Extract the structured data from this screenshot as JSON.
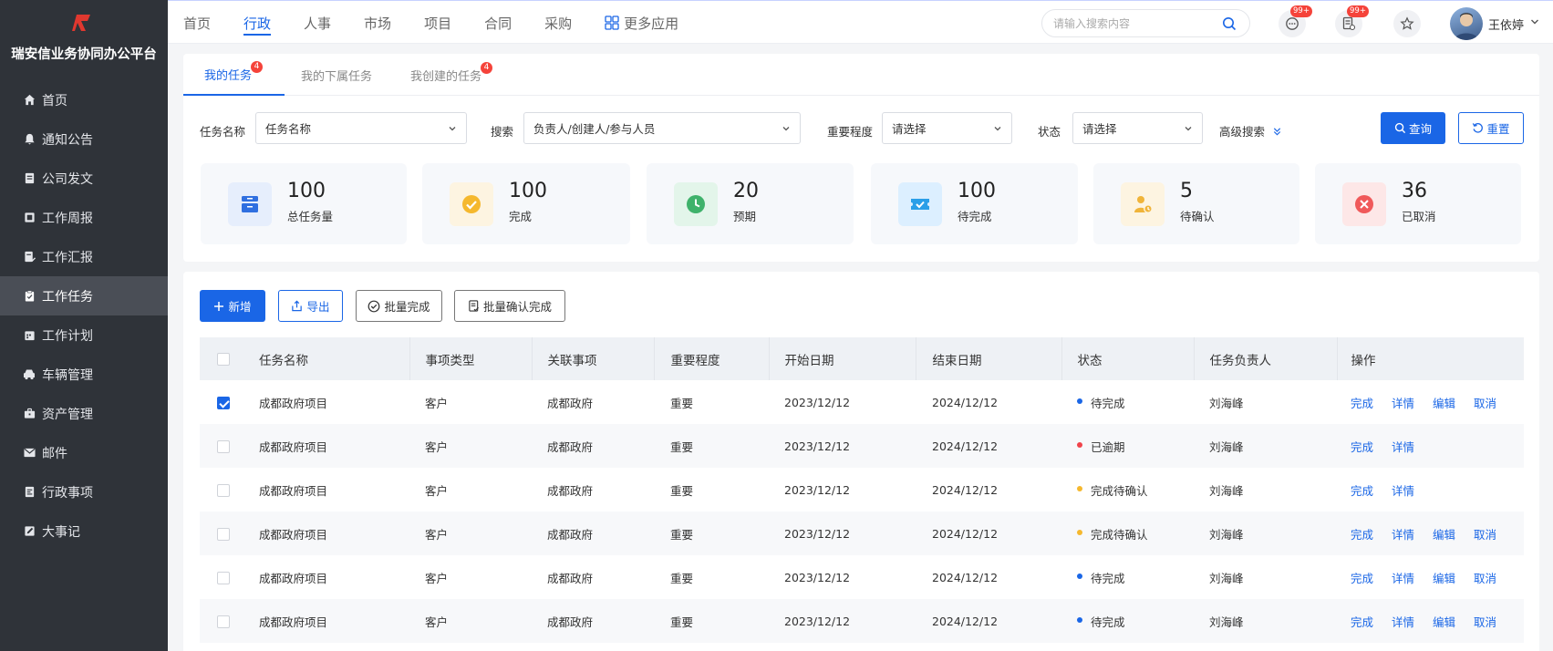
{
  "app": {
    "title": "瑞安信业务协同办公平台"
  },
  "sidebar": {
    "items": [
      {
        "label": "首页",
        "icon": "home-icon"
      },
      {
        "label": "通知公告",
        "icon": "bell-icon"
      },
      {
        "label": "公司发文",
        "icon": "document-icon"
      },
      {
        "label": "工作周报",
        "icon": "report-icon"
      },
      {
        "label": "工作汇报",
        "icon": "edit-document-icon"
      },
      {
        "label": "工作任务",
        "icon": "clipboard-icon",
        "active": true
      },
      {
        "label": "工作计划",
        "icon": "calendar-icon"
      },
      {
        "label": "车辆管理",
        "icon": "car-icon"
      },
      {
        "label": "资产管理",
        "icon": "briefcase-icon"
      },
      {
        "label": "邮件",
        "icon": "mail-icon"
      },
      {
        "label": "行政事项",
        "icon": "file-icon"
      },
      {
        "label": "大事记",
        "icon": "pencil-note-icon"
      }
    ]
  },
  "topnav": {
    "items": [
      "首页",
      "行政",
      "人事",
      "市场",
      "项目",
      "合同",
      "采购",
      "更多应用"
    ],
    "active": "行政"
  },
  "search": {
    "placeholder": "请输入搜索内容"
  },
  "notifications": {
    "messages_badge": "99+",
    "tasks_badge": "99+"
  },
  "user": {
    "name": "王依婷"
  },
  "tabs": [
    {
      "label": "我的任务",
      "badge": "4"
    },
    {
      "label": "我的下属任务"
    },
    {
      "label": "我创建的任务",
      "badge": "4"
    }
  ],
  "filters": {
    "task_name_label": "任务名称",
    "task_name_value": "任务名称",
    "search_label": "搜索",
    "search_value": "负责人/创建人/参与人员",
    "importance_label": "重要程度",
    "importance_value": "请选择",
    "status_label": "状态",
    "status_value": "请选择",
    "advanced": "高级搜索",
    "query_button": "查询",
    "reset_button": "重置"
  },
  "stats": [
    {
      "value": "100",
      "label": "总任务量",
      "color": "#2f6fe0",
      "bg": "#e6eefc"
    },
    {
      "value": "100",
      "label": "完成",
      "color": "#f5b82e",
      "bg": "#fdf4e1"
    },
    {
      "value": "20",
      "label": "预期",
      "color": "#3fb26b",
      "bg": "#e3f5ea"
    },
    {
      "value": "100",
      "label": "待完成",
      "color": "#2a9fe8",
      "bg": "#dcefff"
    },
    {
      "value": "5",
      "label": "待确认",
      "color": "#f0b43a",
      "bg": "#fdf4e1"
    },
    {
      "value": "36",
      "label": "已取消",
      "color": "#f0595a",
      "bg": "#fde7e7"
    }
  ],
  "actions": {
    "add": "新增",
    "export": "导出",
    "batch_complete": "批量完成",
    "batch_confirm": "批量确认完成"
  },
  "table": {
    "columns": [
      "任务名称",
      "事项类型",
      "关联事项",
      "重要程度",
      "开始日期",
      "结束日期",
      "状态",
      "任务负责人",
      "操作"
    ],
    "rows": [
      {
        "checked": true,
        "name": "成都政府项目",
        "type": "客户",
        "related": "成都政府",
        "importance": "重要",
        "start": "2023/12/12",
        "end": "2024/12/12",
        "status": "待完成",
        "status_color": "#1a66e6",
        "owner": "刘海峰",
        "ops": [
          "完成",
          "详情",
          "编辑",
          "取消"
        ]
      },
      {
        "checked": false,
        "name": "成都政府项目",
        "type": "客户",
        "related": "成都政府",
        "importance": "重要",
        "start": "2023/12/12",
        "end": "2024/12/12",
        "status": "已逾期",
        "status_color": "#f0434a",
        "owner": "刘海峰",
        "ops": [
          "完成",
          "详情"
        ]
      },
      {
        "checked": false,
        "name": "成都政府项目",
        "type": "客户",
        "related": "成都政府",
        "importance": "重要",
        "start": "2023/12/12",
        "end": "2024/12/12",
        "status": "完成待确认",
        "status_color": "#f5b82e",
        "owner": "刘海峰",
        "ops": [
          "完成",
          "详情"
        ]
      },
      {
        "checked": false,
        "name": "成都政府项目",
        "type": "客户",
        "related": "成都政府",
        "importance": "重要",
        "start": "2023/12/12",
        "end": "2024/12/12",
        "status": "完成待确认",
        "status_color": "#f5b82e",
        "owner": "刘海峰",
        "ops": [
          "完成",
          "详情",
          "编辑",
          "取消"
        ]
      },
      {
        "checked": false,
        "name": "成都政府项目",
        "type": "客户",
        "related": "成都政府",
        "importance": "重要",
        "start": "2023/12/12",
        "end": "2024/12/12",
        "status": "待完成",
        "status_color": "#1a66e6",
        "owner": "刘海峰",
        "ops": [
          "完成",
          "详情",
          "编辑",
          "取消"
        ]
      },
      {
        "checked": false,
        "name": "成都政府项目",
        "type": "客户",
        "related": "成都政府",
        "importance": "重要",
        "start": "2023/12/12",
        "end": "2024/12/12",
        "status": "待完成",
        "status_color": "#1a66e6",
        "owner": "刘海峰",
        "ops": [
          "完成",
          "详情",
          "编辑",
          "取消"
        ]
      }
    ]
  },
  "colors": {
    "accent": "#1a66e6",
    "sidebar_bg": "#2f3339",
    "logo": "#e0382f"
  }
}
